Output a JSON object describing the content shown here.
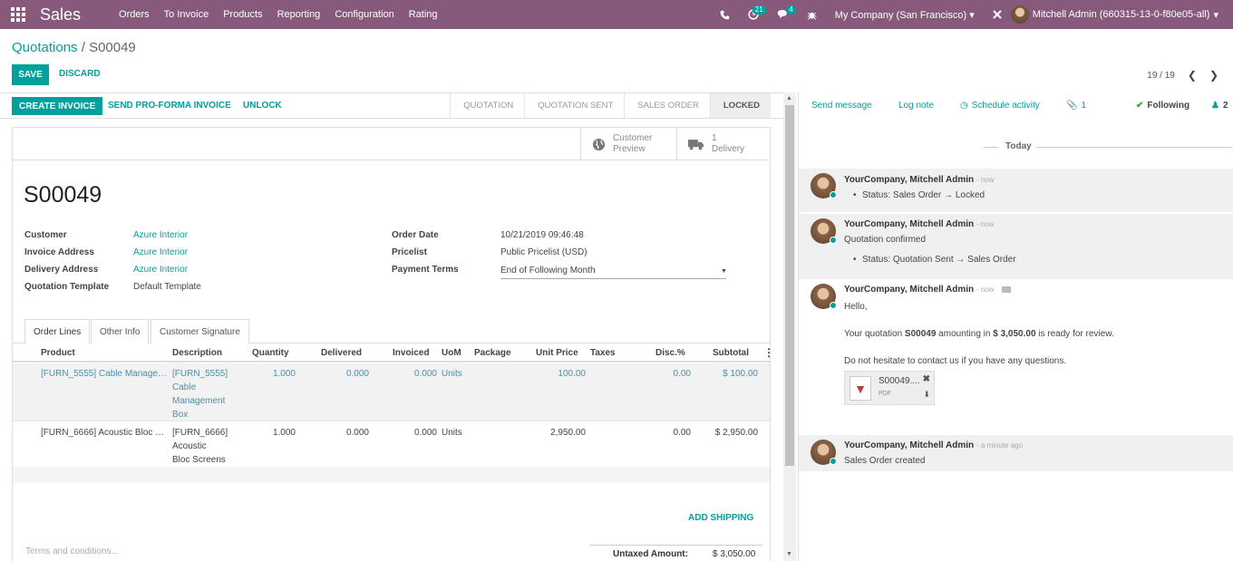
{
  "navbar": {
    "brand": "Sales",
    "menu": [
      "Orders",
      "To Invoice",
      "Products",
      "Reporting",
      "Configuration",
      "Rating"
    ],
    "activity_count": "21",
    "message_count": "4",
    "company": "My Company (San Francisco)",
    "user": "Mitchell Admin (660315-13-0-f80e05-all)"
  },
  "breadcrumb": {
    "parent": "Quotations",
    "separator": "/",
    "current": "S00049"
  },
  "actions": {
    "save": "SAVE",
    "discard": "DISCARD"
  },
  "pager": {
    "value": "19 / 19"
  },
  "statusbar": {
    "create_invoice": "CREATE INVOICE",
    "send_proforma": "SEND PRO-FORMA INVOICE",
    "unlock": "UNLOCK",
    "stages": [
      "QUOTATION",
      "QUOTATION SENT",
      "SALES ORDER",
      "LOCKED"
    ],
    "active_stage": "LOCKED"
  },
  "smart_buttons": {
    "preview_line1": "Customer",
    "preview_line2": "Preview",
    "delivery_count": "1",
    "delivery_label": "Delivery"
  },
  "order": {
    "name": "S00049",
    "customer_label": "Customer",
    "customer": "Azure Interior",
    "invoice_address_label": "Invoice Address",
    "invoice_address": "Azure Interior",
    "delivery_address_label": "Delivery Address",
    "delivery_address": "Azure Interior",
    "template_label": "Quotation Template",
    "template": "Default Template",
    "order_date_label": "Order Date",
    "order_date": "10/21/2019 09:46:48",
    "pricelist_label": "Pricelist",
    "pricelist": "Public Pricelist (USD)",
    "payment_terms_label": "Payment Terms",
    "payment_terms": "End of Following Month"
  },
  "tabs": [
    "Order Lines",
    "Other Info",
    "Customer Signature"
  ],
  "table": {
    "headers": [
      "Product",
      "Description",
      "Quantity",
      "Delivered",
      "Invoiced",
      "UoM",
      "Package",
      "Unit Price",
      "Taxes",
      "Disc.%",
      "Subtotal"
    ],
    "rows": [
      {
        "product": "[FURN_5555] Cable Manage…",
        "description": [
          "[FURN_5555]",
          "Cable",
          "Management",
          "Box"
        ],
        "quantity": "1.000",
        "delivered": "0.000",
        "invoiced": "0.000",
        "uom": "Units",
        "unit_price": "100.00",
        "discount": "0.00",
        "subtotal": "$ 100.00"
      },
      {
        "product": "[FURN_6666] Acoustic Bloc …",
        "description": [
          "[FURN_6666]",
          "Acoustic",
          "Bloc Screens"
        ],
        "quantity": "1.000",
        "delivered": "0.000",
        "invoiced": "0.000",
        "uom": "Units",
        "unit_price": "2,950.00",
        "discount": "0.00",
        "subtotal": "$ 2,950.00"
      }
    ]
  },
  "footer": {
    "add_shipping": "ADD SHIPPING",
    "terms_placeholder": "Terms and conditions...",
    "untaxed_label": "Untaxed Amount:",
    "untaxed_value": "$ 3,050.00"
  },
  "chatter": {
    "send_message": "Send message",
    "log_note": "Log note",
    "schedule_activity": "Schedule activity",
    "attachments_count": "1",
    "following": "Following",
    "followers_count": "2",
    "today": "Today",
    "messages": [
      {
        "author": "YourCompany, Mitchell Admin",
        "when": "- now",
        "bullet": "Status: Sales Order → Locked"
      },
      {
        "author": "YourCompany, Mitchell Admin",
        "when": "- now",
        "text": "Quotation confirmed",
        "bullet": "Status: Quotation Sent → Sales Order"
      },
      {
        "author": "YourCompany, Mitchell Admin",
        "when": "- now",
        "hello": "Hello,",
        "body_prefix": "Your quotation ",
        "body_ref": "S00049",
        "body_mid": " amounting in ",
        "body_amount": "$ 3,050.00",
        "body_suffix": " is ready for review.",
        "closing": "Do not hesitate to contact us if you have any questions.",
        "attachment_name": "S00049....",
        "attachment_type": "PDF"
      },
      {
        "author": "YourCompany, Mitchell Admin",
        "when": "- a minute ago",
        "text": "Sales Order created"
      }
    ]
  }
}
